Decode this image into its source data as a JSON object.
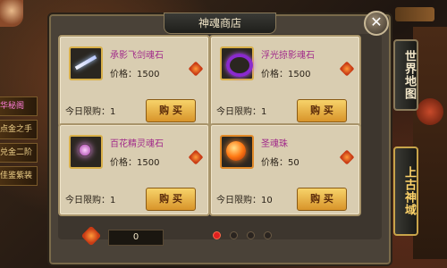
{
  "shop": {
    "title": "神魂商店",
    "close_label": "✕"
  },
  "side_tabs": {
    "world_map": "世界地图",
    "ancient_domain": "上古神域"
  },
  "left_menu": [
    "华秘阁",
    "点金之手",
    "兑金二阶",
    "佳鉴紫装"
  ],
  "items": [
    {
      "name": "承影飞剑魂石",
      "price": "价格：1500",
      "limit": "今日限购：1",
      "buy": "购 买",
      "icon": "sword-icon"
    },
    {
      "name": "浮光掠影魂石",
      "price": "价格：1500",
      "limit": "今日限购：1",
      "buy": "购 买",
      "icon": "ring-icon"
    },
    {
      "name": "百花精灵魂石",
      "price": "价格：1500",
      "limit": "今日限购：1",
      "buy": "购 买",
      "icon": "fairy-icon"
    },
    {
      "name": "圣魂珠",
      "price": "价格：50",
      "limit": "今日限购：10",
      "buy": "购 买",
      "icon": "orb-icon"
    }
  ],
  "footer": {
    "currency_amount": "0",
    "page_current": 1,
    "page_total": 4
  },
  "colors": {
    "item_name": "#a12a8a",
    "buy_button": "#f7d36a",
    "active_dot": "#e02020"
  }
}
